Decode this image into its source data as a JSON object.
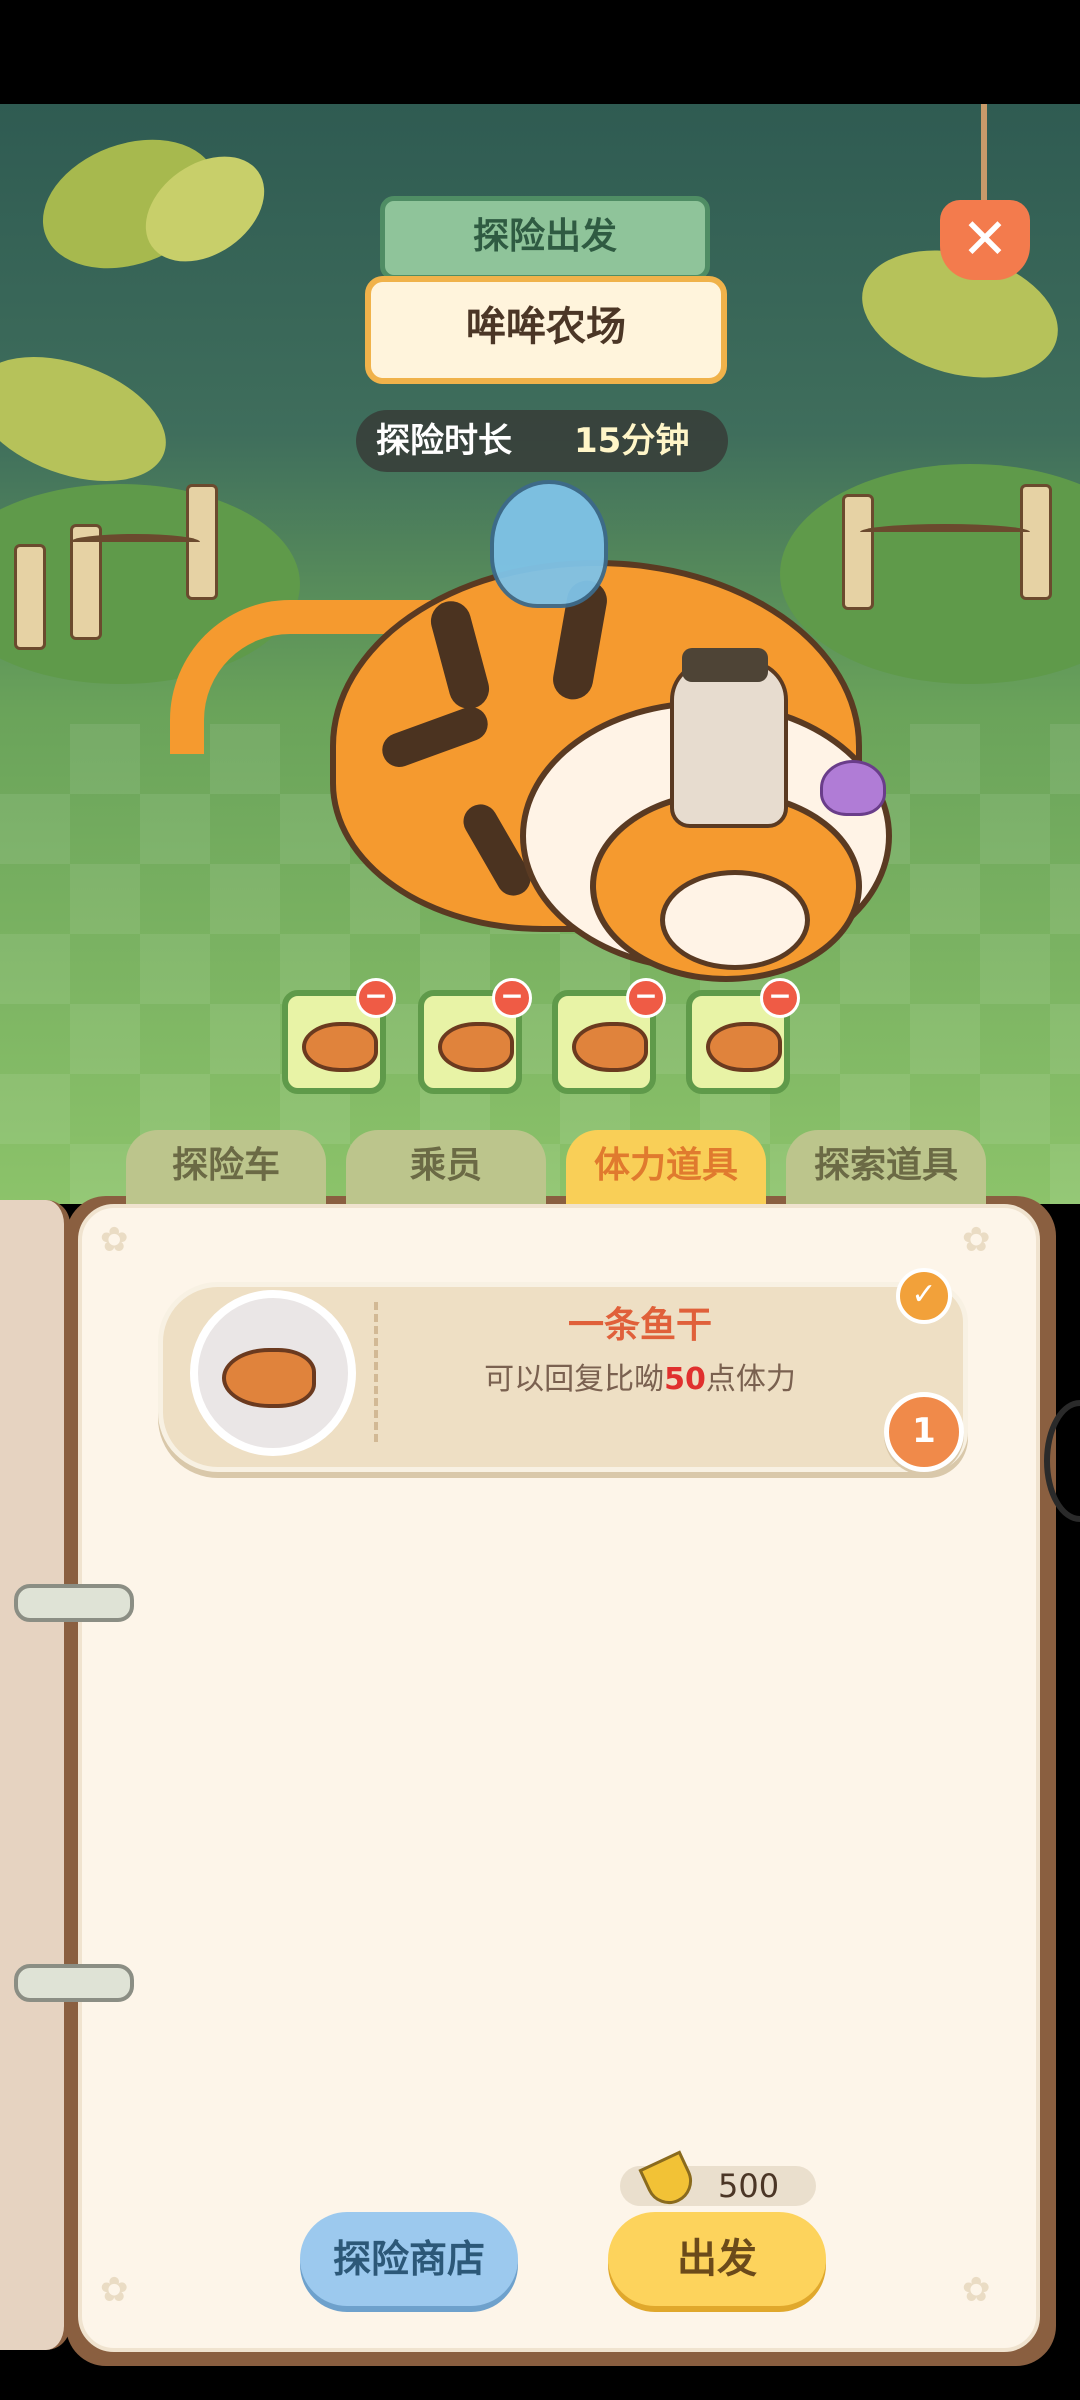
{
  "header": {
    "title": "探险出发",
    "location": "哞哞农场",
    "duration_label": "探险时长",
    "duration_value": "15分钟",
    "close_icon": "close-icon"
  },
  "stamina_slots": [
    {
      "item": "fish-icon",
      "remove_icon": "minus-icon"
    },
    {
      "item": "fish-icon",
      "remove_icon": "minus-icon"
    },
    {
      "item": "fish-icon",
      "remove_icon": "minus-icon"
    },
    {
      "item": "fish-icon",
      "remove_icon": "minus-icon"
    }
  ],
  "tabs": [
    {
      "label": "探险车",
      "active": false
    },
    {
      "label": "乘员",
      "active": false
    },
    {
      "label": "体力道具",
      "active": true
    },
    {
      "label": "探索道具",
      "active": false
    }
  ],
  "items": [
    {
      "name": "一条鱼干",
      "desc_prefix": "可以回复比呦",
      "desc_value": "50",
      "desc_suffix": "点体力",
      "count": "1",
      "selected": true
    }
  ],
  "footer": {
    "cost": "500",
    "cost_icon": "banana-icon",
    "shop_button": "探险商店",
    "go_button": "出发"
  },
  "colors": {
    "active_tab": "#f9cf57",
    "accent_orange": "#e0603a",
    "highlight_red": "#e0302e",
    "go_button": "#fdd35c",
    "shop_button": "#9cc9ee"
  }
}
